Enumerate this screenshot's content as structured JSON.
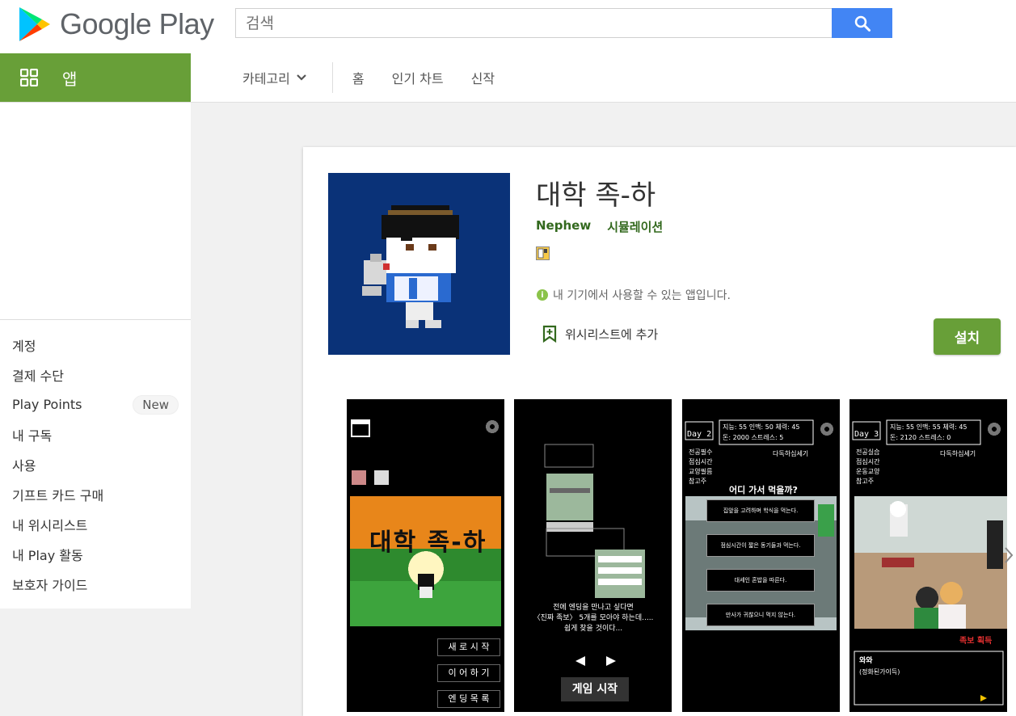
{
  "header": {
    "brand": "Google Play",
    "search_placeholder": "검색"
  },
  "nav": {
    "section_label": "앱",
    "category_label": "카테고리",
    "items": [
      {
        "label": "홈"
      },
      {
        "label": "인기 차트"
      },
      {
        "label": "신작"
      }
    ]
  },
  "sidebar": {
    "links": [
      {
        "label": "계정"
      },
      {
        "label": "결제 수단"
      },
      {
        "label": "Play Points",
        "badge": "New"
      },
      {
        "label": "내 구독"
      },
      {
        "label": "사용"
      },
      {
        "label": "기프트 카드 구매"
      },
      {
        "label": "내 위시리스트"
      },
      {
        "label": "내 Play 활동"
      },
      {
        "label": "보호자 가이드"
      }
    ]
  },
  "app": {
    "title": "대학 족-하",
    "developer": "Nephew",
    "category": "시뮬레이션",
    "availability": "내 기기에서 사용할 수 있는 앱입니다.",
    "wishlist_label": "위시리스트에 추가",
    "install_label": "설치"
  },
  "screenshots": [
    {
      "title_art": "대학 족-하",
      "menu": [
        "새 로 시 작",
        "이 어 하 기",
        "엔 딩 목 록"
      ]
    },
    {
      "story_lines": [
        "전에 엔딩을 만나고 싶다면",
        "〈진짜 족보〉 5개를 모아야 하는데.....",
        "쉽게 찾을 것이다..."
      ],
      "button": "게임 시작"
    },
    {
      "day": "Day 2",
      "stats": [
        "지능: 55",
        "인맥: 50",
        "체력: 45",
        "돈: 2000",
        "스트레스: 5"
      ],
      "menu": [
        "전공필수",
        "점심시간",
        "교양필름",
        "참고주"
      ],
      "tag": "다독하십세기",
      "question": "어디 가서 먹을까?",
      "choices": [
        "집앞을 고려하며 학식을 먹는다.",
        "점심시간이 짧은 동기들과 먹는다.",
        "대세인 혼밥을 따른다.",
        "만사가 귀찮으니 먹지 않는다."
      ]
    },
    {
      "day": "Day 3",
      "stats": [
        "지능: 55",
        "인맥: 55",
        "체력: 45",
        "돈: 2120",
        "스트레스: 0"
      ],
      "menu": [
        "전공실습",
        "점심시간",
        "운동교양",
        "참고주"
      ],
      "tag": "다독하십세기",
      "found": "족보 획득",
      "dialog_name": "와와",
      "dialog_text": "(정화된가이득)"
    }
  ]
}
